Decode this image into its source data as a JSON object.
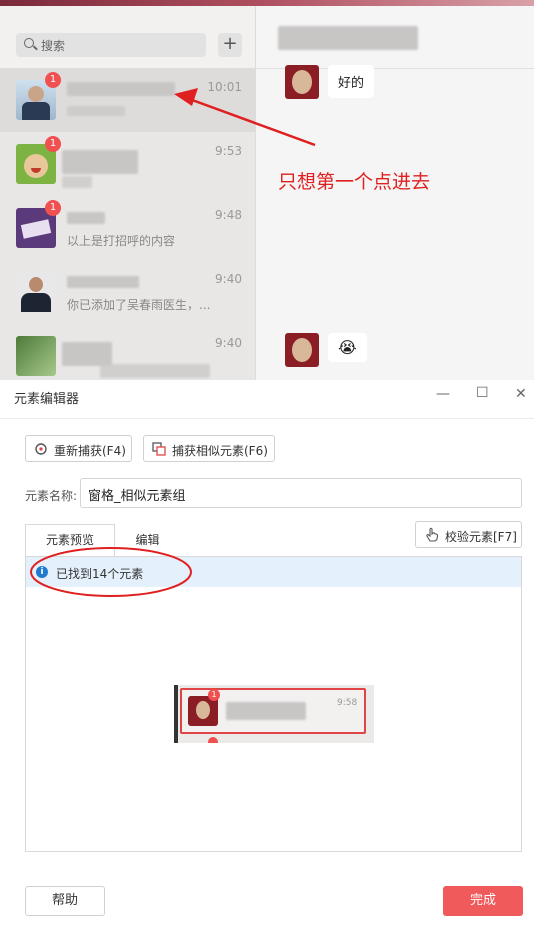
{
  "chat_app": {
    "search_placeholder": "搜索",
    "plus_label": "+",
    "chats": [
      {
        "time": "10:01",
        "badge": "1",
        "preview": "",
        "avatar_icon": "man-in-suit-avatar-icon"
      },
      {
        "time": "9:53",
        "badge": "1",
        "preview": "",
        "avatar_icon": "green-dog-avatar-icon"
      },
      {
        "time": "9:48",
        "badge": "1",
        "preview": "以上是打招呼的内容",
        "avatar_icon": "purple-card-avatar-icon"
      },
      {
        "time": "9:40",
        "badge": "",
        "preview": "你已添加了吴春雨医生，...",
        "avatar_icon": "man-in-suit-avatar-icon"
      },
      {
        "time": "9:40",
        "badge": "",
        "preview": "",
        "avatar_icon": "green-plant-avatar-icon"
      }
    ],
    "messages": [
      {
        "text": "好的"
      },
      {
        "text": "😭"
      }
    ]
  },
  "annotation": {
    "text": "只想第一个点进去",
    "color": "#e02020"
  },
  "editor": {
    "title": "元素编辑器",
    "window_buttons": {
      "minimize": "—",
      "maximize": "☐",
      "close": "✕"
    },
    "recapture_label": "重新捕获(F4)",
    "capture_similar_label": "捕获相似元素(F6)",
    "name_label": "元素名称:",
    "name_value": "窗格_相似元素组",
    "tabs": [
      "元素预览",
      "编辑"
    ],
    "verify_label": "校验元素[F7]",
    "found_text": "已找到14个元素",
    "info_icon": "i",
    "thumbnail": {
      "time": "9:58",
      "badge": "1"
    },
    "help_label": "帮助",
    "done_label": "完成",
    "accent_color": "#f05a5a"
  }
}
